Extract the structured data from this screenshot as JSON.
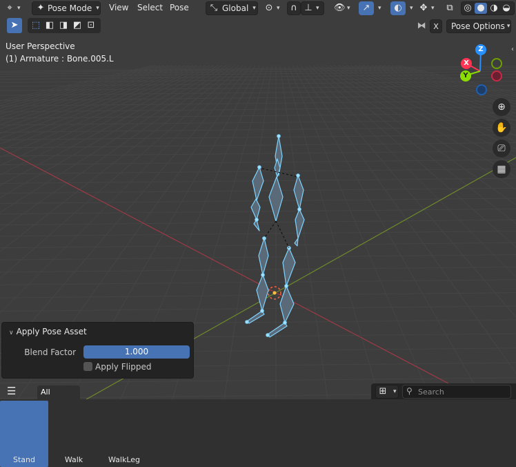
{
  "header": {
    "mode_label": "Pose Mode",
    "menus": [
      "View",
      "Select",
      "Pose"
    ],
    "orientation_label": "Global",
    "pose_options_label": "Pose Options",
    "x_toggle_label": "X"
  },
  "viewport": {
    "perspective_label": "User Perspective",
    "active_object_label": "(1) Armature : Bone.005.L"
  },
  "gizmo": {
    "z": "Z",
    "x": "X",
    "y": "Y"
  },
  "redo_panel": {
    "title": "Apply Pose Asset",
    "blend_label": "Blend Factor",
    "blend_value": "1.000",
    "flip_label": "Apply Flipped",
    "flip_checked": false
  },
  "shelf": {
    "tab_label": "All",
    "search_placeholder": "Search",
    "assets": [
      {
        "label": "Stand",
        "selected": true
      },
      {
        "label": "Walk",
        "selected": false
      },
      {
        "label": "WalkLeg",
        "selected": false
      }
    ]
  },
  "colors": {
    "accent": "#4772b3",
    "axis_x": "#ff3352",
    "axis_y": "#8bdc00",
    "axis_z": "#2890ff",
    "bone": "#7fd4ff"
  }
}
